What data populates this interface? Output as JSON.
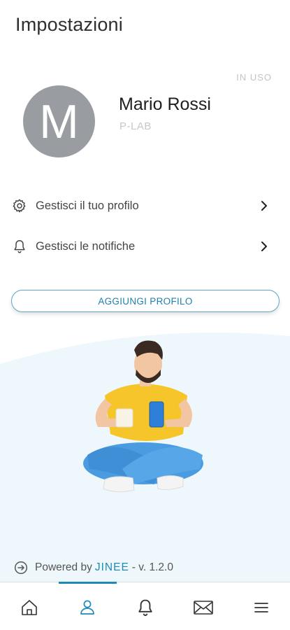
{
  "header": {
    "title": "Impostazioni"
  },
  "profile": {
    "status": "IN USO",
    "avatar_letter": "M",
    "name": "Mario Rossi",
    "organization": "P-LAB"
  },
  "menu": {
    "items": [
      {
        "label": "Gestisci il tuo profilo",
        "icon": "gear-icon"
      },
      {
        "label": "Gestisci le notifiche",
        "icon": "bell-icon"
      }
    ]
  },
  "actions": {
    "add_profile_label": "AGGIUNGI PROFILO"
  },
  "footer": {
    "powered_prefix": "Powered by",
    "brand": "JINEE",
    "version": "- v. 1.2.0"
  },
  "tabbar": {
    "items": [
      {
        "name": "home",
        "icon": "home-icon"
      },
      {
        "name": "profile",
        "icon": "user-icon",
        "active": true
      },
      {
        "name": "notifications",
        "icon": "bell-icon"
      },
      {
        "name": "messages",
        "icon": "envelope-icon"
      },
      {
        "name": "menu",
        "icon": "hamburger-icon"
      }
    ]
  },
  "colors": {
    "accent": "#1f8ab8",
    "avatar_bg": "#999da1",
    "panel_bg": "#eef7fb"
  }
}
